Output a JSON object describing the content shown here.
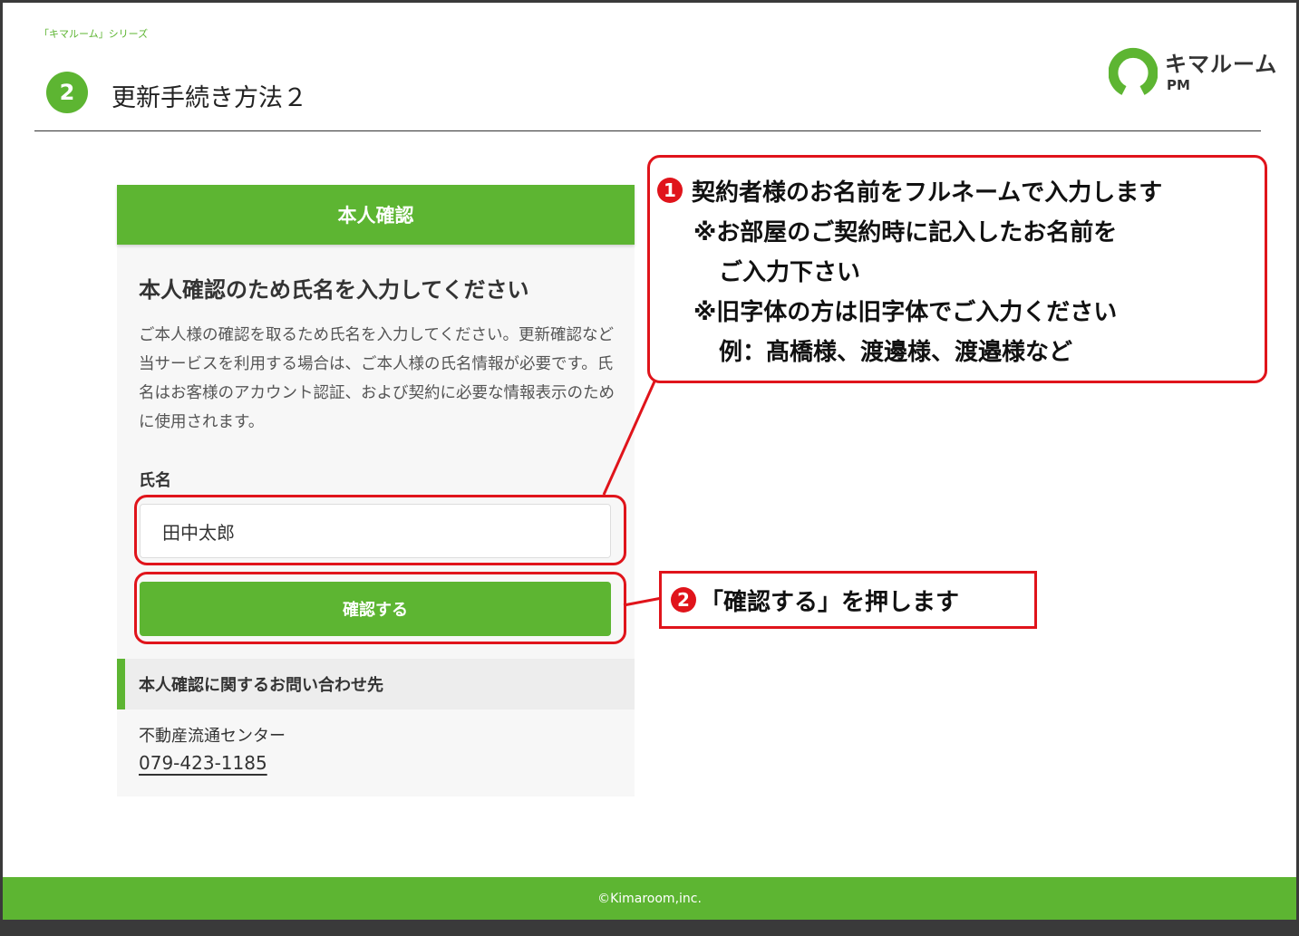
{
  "header": {
    "series": "「キマルーム」シリーズ",
    "step_number": "2",
    "title": "更新手続き方法２",
    "logo_main": "キマルーム",
    "logo_sub": "PM"
  },
  "card": {
    "header": "本人確認",
    "heading": "本人確認のため氏名を入力してください",
    "description": "ご本人様の確認を取るため氏名を入力してください。更新確認など当サービスを利用する場合は、ご本人様の氏名情報が必要です。氏名はお客様のアカウント認証、および契約に必要な情報表示のために使用されます。",
    "name_label": "氏名",
    "name_value": "田中太郎",
    "confirm_button": "確認する",
    "contact_heading": "本人確認に関するお問い合わせ先",
    "contact_name": "不動産流通センター",
    "contact_phone": "079-423-1185"
  },
  "annotations": {
    "one": {
      "badge": "1",
      "line1": "契約者様のお名前をフルネームで入力します",
      "line2": "※お部屋のご契約時に記入したお名前を",
      "line3": "ご入力下さい",
      "line4": "※旧字体の方は旧字体でご入力ください",
      "line5": "例：髙橋様、渡邊様、渡邉様など"
    },
    "two": {
      "badge": "2",
      "text": "「確認する」を押します"
    }
  },
  "footer": {
    "copyright": "©Kimaroom,inc."
  },
  "colors": {
    "brand_green": "#5db532",
    "annotation_red": "#e0141b"
  }
}
